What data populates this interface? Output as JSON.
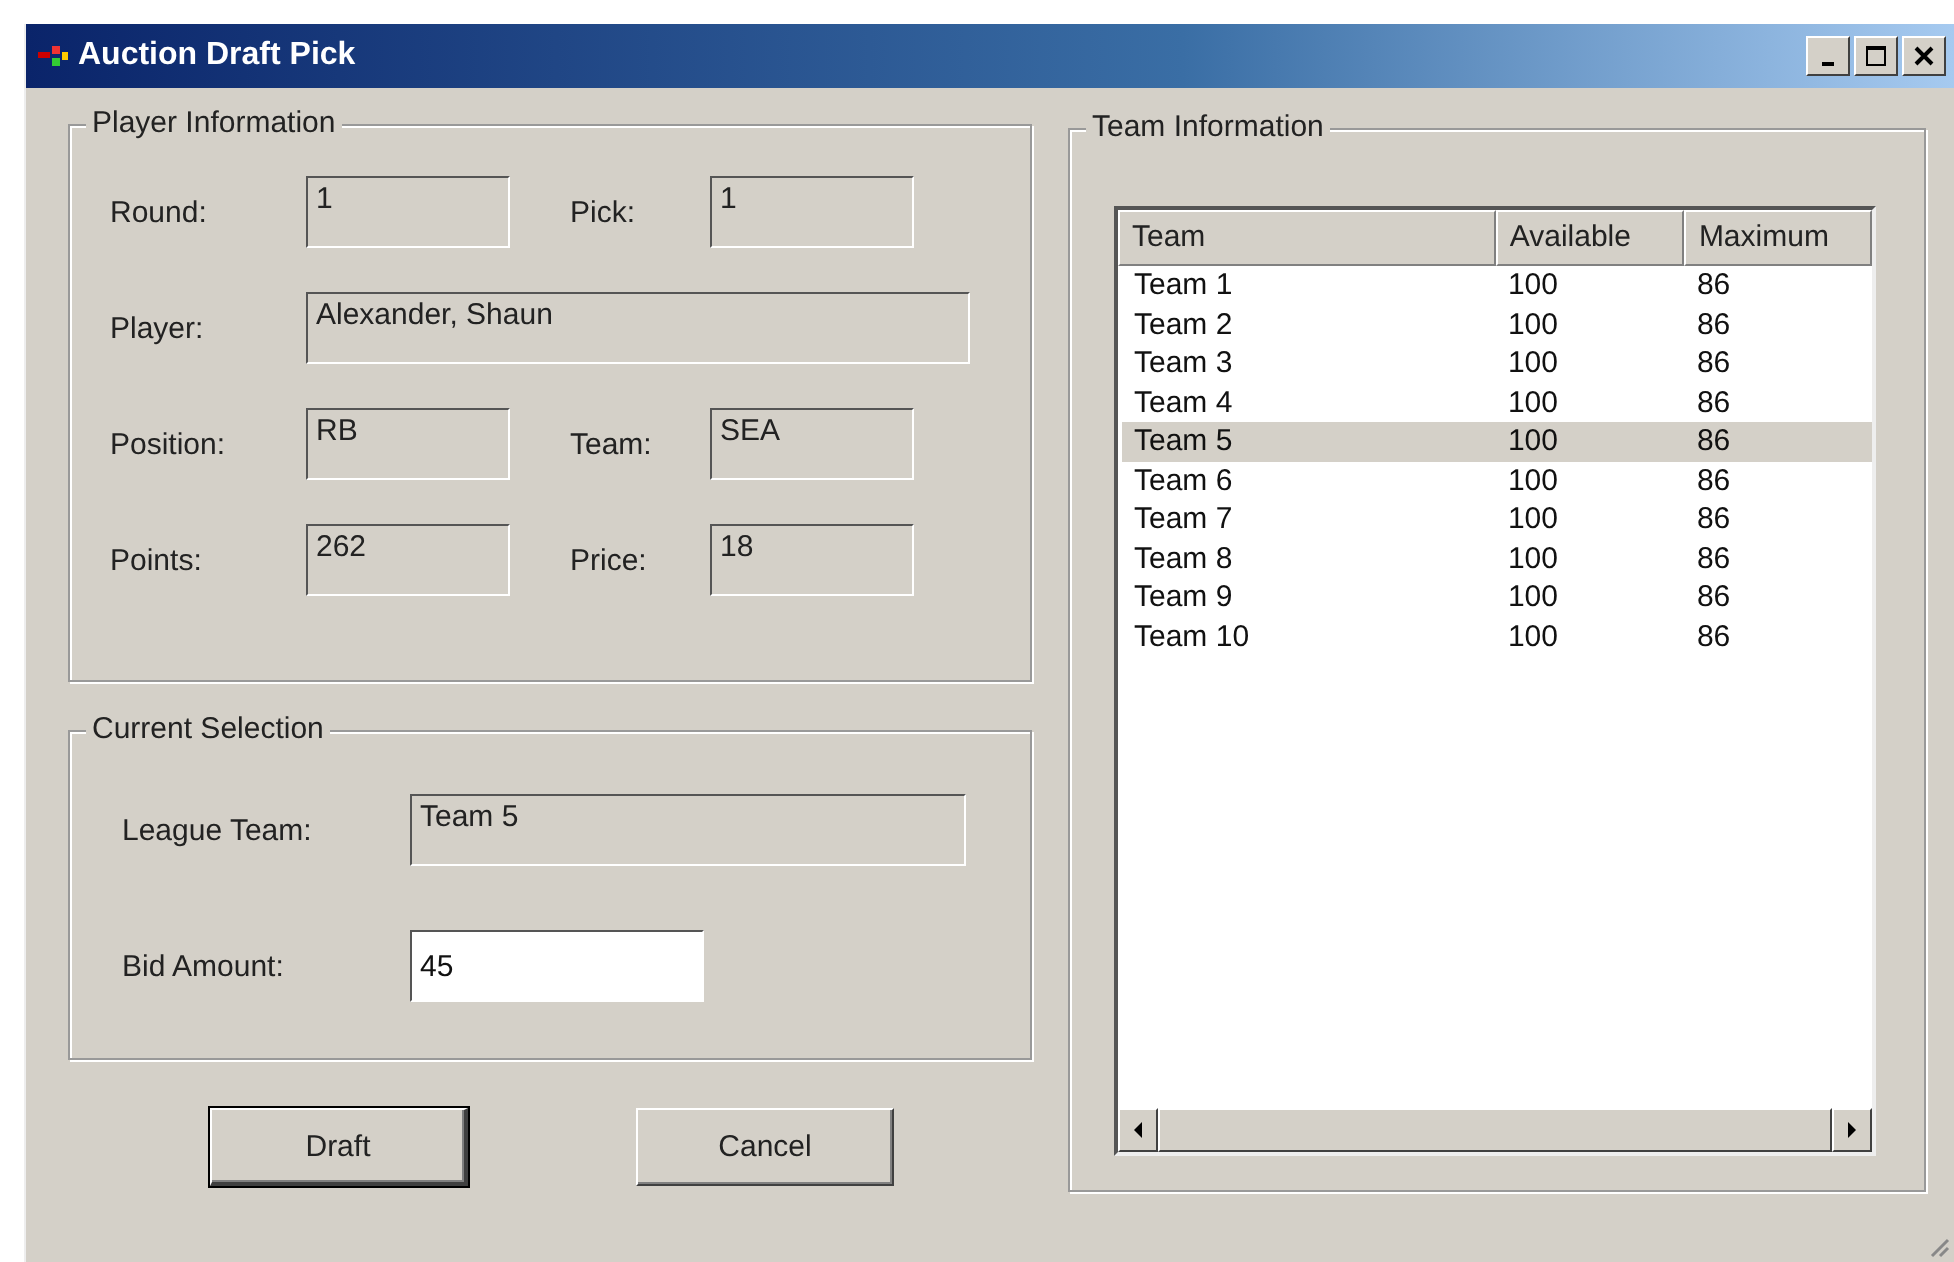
{
  "window": {
    "title": "Auction Draft Pick"
  },
  "player_information": {
    "title": "Player Information",
    "rows": [
      [
        {
          "label": "Round:",
          "value": "1"
        },
        {
          "label": "Pick:",
          "value": "1"
        }
      ],
      [
        {
          "label": "Player:",
          "value": "Alexander, Shaun",
          "wide": true
        }
      ],
      [
        {
          "label": "Position:",
          "value": "RB"
        },
        {
          "label": "Team:",
          "value": "SEA"
        }
      ],
      [
        {
          "label": "Points:",
          "value": "262"
        },
        {
          "label": "Price:",
          "value": "18"
        }
      ]
    ]
  },
  "current_selection": {
    "title": "Current Selection",
    "league_team": {
      "label": "League Team:",
      "value": "Team 5"
    },
    "bid_amount": {
      "label": "Bid Amount:",
      "value": "45"
    }
  },
  "buttons": [
    {
      "label": "Draft",
      "default": true
    },
    {
      "label": "Cancel",
      "default": false
    }
  ],
  "team_information": {
    "title": "Team Information",
    "columns": [
      "Team",
      "Available",
      "Maximum"
    ],
    "rows": [
      {
        "cells": [
          "Team 1",
          "100",
          "86"
        ],
        "selected": false
      },
      {
        "cells": [
          "Team 2",
          "100",
          "86"
        ],
        "selected": false
      },
      {
        "cells": [
          "Team 3",
          "100",
          "86"
        ],
        "selected": false
      },
      {
        "cells": [
          "Team 4",
          "100",
          "86"
        ],
        "selected": false
      },
      {
        "cells": [
          "Team 5",
          "100",
          "86"
        ],
        "selected": true
      },
      {
        "cells": [
          "Team 6",
          "100",
          "86"
        ],
        "selected": false
      },
      {
        "cells": [
          "Team 7",
          "100",
          "86"
        ],
        "selected": false
      },
      {
        "cells": [
          "Team 8",
          "100",
          "86"
        ],
        "selected": false
      },
      {
        "cells": [
          "Team 9",
          "100",
          "86"
        ],
        "selected": false
      },
      {
        "cells": [
          "Team 10",
          "100",
          "86"
        ],
        "selected": false
      }
    ]
  }
}
